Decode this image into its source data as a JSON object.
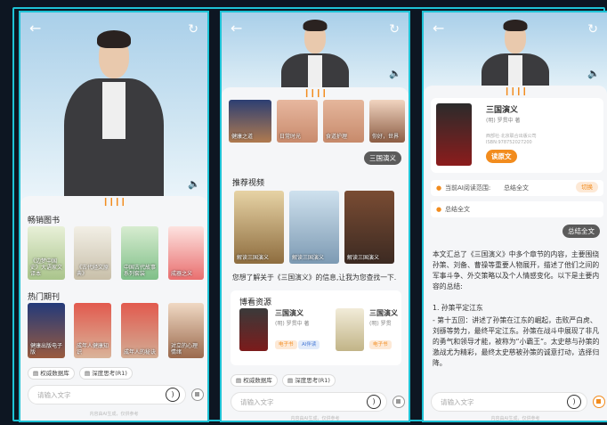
{
  "colors": {
    "accent": "#f28c1e",
    "frame": "#1ec3d6",
    "tag_blue": "#4a7bd6"
  },
  "icons": {
    "back": "arrow-left-icon",
    "refresh": "refresh-icon",
    "speaker": "speaker-icon",
    "mic": "mic-icon",
    "stop": "stop-icon"
  },
  "p1": {
    "section_books": "畅销图书",
    "books": [
      "《边梦中国史》大语家文译本",
      "《古代经文原典》",
      "中国古代故事系列套装",
      "成器之义"
    ],
    "section_journals": "热门期刊",
    "journals": [
      "健康出版电子版",
      "成年人健康知识",
      "成年人的秘诀",
      "对立的心理情绪"
    ],
    "chips": [
      "权威数据库",
      "深度思考(R1)"
    ],
    "input_placeholder": "请输入文字",
    "footer": "内容由AI生成，仅供参考"
  },
  "p2": {
    "top_covers": [
      "健康之道",
      "日常时光",
      "食道护理",
      "你好，世界"
    ],
    "reply_pill": "三国演义",
    "section_video": "推荐视频",
    "videos": [
      "解读三国演义"
    ],
    "reply_text": "您想了解关于《三国演义》的信息,让我为您查找一下.",
    "section_res": "博看资源",
    "res": [
      {
        "title": "三国演义",
        "author": "(明) 罗贯中 著",
        "tags": [
          "电子书",
          "AI伴读"
        ]
      },
      {
        "title": "三国演义",
        "author": "(明) 罗贯",
        "tags": [
          "电子书"
        ]
      }
    ],
    "chips": [
      "权威数据库",
      "深度思考(R1)"
    ],
    "input_placeholder": "请输入文字",
    "footer": "内容由AI生成，仅供参考"
  },
  "p3": {
    "book_title": "三国演义",
    "book_author": "(明) 罗贯中 著",
    "book_publisher": "西部社·北京联合出版公司",
    "book_isbn": "ISBN:978752027200",
    "read_button": "读原文",
    "scope_label": "当前AI阅读范围:",
    "scope_value": "总结全文",
    "switch_label": "切换",
    "summary_label": "总结全文",
    "reply_pill": "总结全文",
    "answer": "本文汇总了《三国演义》中多个章节的内容，主要围绕孙策、刘备、曹操等重要人物展开，描述了他们之间的军事斗争、外交策略以及个人情感变化。以下是主要内容的总结:",
    "point_title": "1. 孙策平定江东",
    "point_body": "- 第十五回：讲述了孙策在江东的崛起，击败严白虎、刘繇等势力，最终平定江东。孙策在战斗中展现了非凡的勇气和领导才能，被称为“小霸王”。太史慈与孙策的激战尤为精彩，最终太史慈被孙策的诚意打动，选择归降。",
    "input_placeholder": "请输入文字",
    "footer": "内容由AI生成，仅供参考"
  }
}
